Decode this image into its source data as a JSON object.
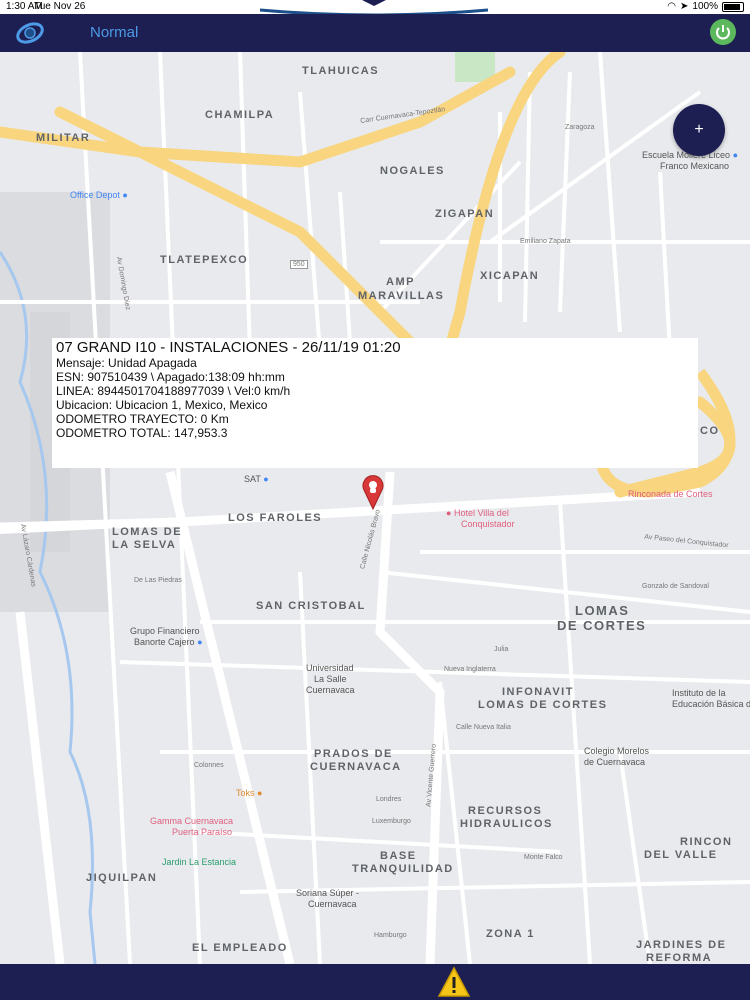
{
  "status_bar": {
    "time": "1:30 AM",
    "date": "Tue Nov 26",
    "battery": "100%"
  },
  "header": {
    "title": "Normal",
    "logo_icon": "globe-logo-icon",
    "power_icon": "power-icon"
  },
  "colors": {
    "navbar": "#1d1e52",
    "title": "#4d9ae6",
    "power": "#5cb85c",
    "road_major": "#f8d57e",
    "pin": "#d93838"
  },
  "fab": {
    "label": "+"
  },
  "info": {
    "title": "07 GRAND I10 - INSTALACIONES - 26/11/19 01:20",
    "mensaje": "Mensaje: Unidad Apagada",
    "esn": "ESN: 907510439 \\ Apagado:138:09 hh:mm",
    "linea": "LINEA: 8944501704188977039 \\ Vel:0 km/h",
    "ubicacion": "Ubicacion: Ubicacion 1, Mexico, Mexico",
    "odometro_trayecto": "ODOMETRO TRAYECTO: 0 Km",
    "odometro_total": "ODOMETRO TOTAL:  147,953.3"
  },
  "map": {
    "neighborhoods": {
      "tlahuicas": "TLAHUICAS",
      "chamilpa": "CHAMILPA",
      "militar": "MILITAR",
      "nogales": "NOGALES",
      "zigapan": "ZIGAPAN",
      "tlatepexco": "TLATEPEXCO",
      "xicapan": "XICAPAN",
      "amp": "AMP",
      "maravillas": "MARAVILLAS",
      "los_faroles": "LOS FAROLES",
      "lomas_de": "LOMAS DE",
      "la_selva": "LA SELVA",
      "san_cristobal": "SAN CRISTOBAL",
      "lomas": "LOMAS",
      "de_cortes": "DE CORTES",
      "infonavit": "INFONAVIT",
      "lomas_de_cortes": "LOMAS DE CORTES",
      "prados_de": "PRADOS DE",
      "cuernavaca": "CUERNAVACA",
      "recursos": "RECURSOS",
      "hidraulicos": "HIDRAULICOS",
      "base": "BASE",
      "tranquilidad": "TRANQUILIDAD",
      "rincon": "RINCON",
      "del_valle": "DEL VALLE",
      "jiquilpan": "JIQUILPAN",
      "el_empleado": "EL EMPLEADO",
      "zona_1": "ZONA 1",
      "jardines_de": "JARDINES DE",
      "reforma": "REFORMA",
      "co": "CO"
    },
    "pois": {
      "office_depot": "Office Depot",
      "escuela_1": "Escuela Moliere Liceo",
      "escuela_2": "Franco Mexicano",
      "sat": "SAT",
      "hotel_1": "Hotel Villa del",
      "hotel_2": "Conquistador",
      "rinconada": "Rinconada de Cortes",
      "grupo_1": "Grupo Financiero",
      "grupo_2": "Banorte Cajero",
      "universidad_1": "Universidad",
      "universidad_2": "La Salle",
      "universidad_3": "Cuernavaca",
      "instituto_1": "Instituto de la",
      "instituto_2": "Educación Básica del",
      "colegio_1": "Colegio Morelos",
      "colegio_2": "de Cuernavaca",
      "toks": "Toks",
      "gamma_1": "Gamma Cuernavaca",
      "gamma_2": "Puerta Paraíso",
      "jardin": "Jardin La Estancia",
      "soriana_1": "Soriana Súper -",
      "soriana_2": "Cuernavaca"
    },
    "streets": {
      "carr": "Carr Cuernavaca-Tepoztlán",
      "emiliano": "Emiliano Zapata",
      "paseo": "Av Paseo del Conquistador",
      "nueva_inglaterra": "Nueva Inglaterra",
      "calle_nueva_italia": "Calle Nueva Italia",
      "vicente": "Av Vicente Guerrero",
      "lazaro": "Av Lázaro Cárdenas",
      "domingo": "Av Domingo Diez",
      "nicolas": "Calle Nicolás Bravo",
      "route": "950",
      "zaragoza": "Zaragoza",
      "gonzalo": "Gonzalo de Sandoval",
      "colonnes": "Colonnes",
      "londres": "Londres",
      "luxemburgo": "Luxemburgo",
      "montefalco": "Monte Falco",
      "hamburgo": "Hamburgo",
      "julia": "Julia",
      "las_piedras": "De Las Piedras"
    }
  },
  "bottom": {
    "warning_icon": "warning-icon"
  }
}
